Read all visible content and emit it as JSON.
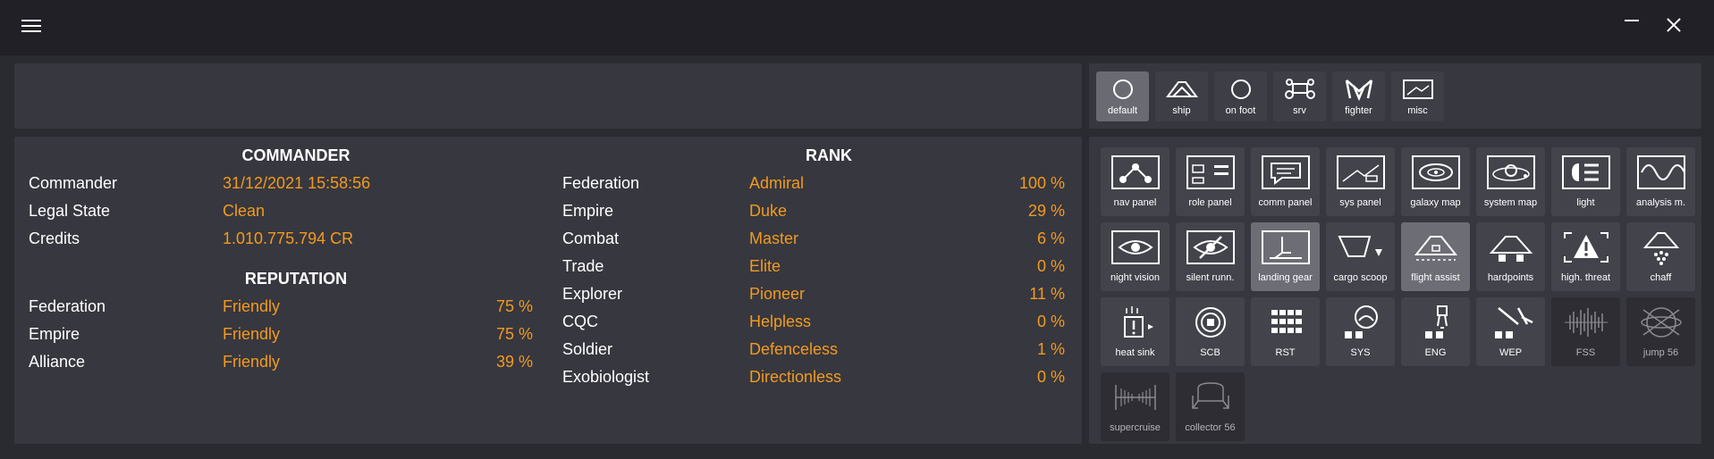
{
  "commander": {
    "title": "COMMANDER",
    "rows": [
      {
        "label": "Commander",
        "value": "31/12/2021 15:58:56"
      },
      {
        "label": "Legal State",
        "value": "Clean"
      },
      {
        "label": "Credits",
        "value": "1.010.775.794 CR"
      }
    ]
  },
  "reputation": {
    "title": "REPUTATION",
    "rows": [
      {
        "label": "Federation",
        "value": "Friendly",
        "percent": "75 %"
      },
      {
        "label": "Empire",
        "value": "Friendly",
        "percent": "75 %"
      },
      {
        "label": "Alliance",
        "value": "Friendly",
        "percent": "39 %"
      }
    ]
  },
  "rank": {
    "title": "RANK",
    "rows": [
      {
        "label": "Federation",
        "value": "Admiral",
        "percent": "100 %"
      },
      {
        "label": "Empire",
        "value": "Duke",
        "percent": "29 %"
      },
      {
        "label": "Combat",
        "value": "Master",
        "percent": "6 %"
      },
      {
        "label": "Trade",
        "value": "Elite",
        "percent": "0 %"
      },
      {
        "label": "Explorer",
        "value": "Pioneer",
        "percent": "11 %"
      },
      {
        "label": "CQC",
        "value": "Helpless",
        "percent": "0 %"
      },
      {
        "label": "Soldier",
        "value": "Defenceless",
        "percent": "1 %"
      },
      {
        "label": "Exobiologist",
        "value": "Directionless",
        "percent": "0 %"
      }
    ]
  },
  "modes": [
    {
      "label": "default",
      "icon": "circle-icon",
      "active": true
    },
    {
      "label": "ship",
      "icon": "ship-icon",
      "active": false
    },
    {
      "label": "on foot",
      "icon": "circle-icon",
      "active": false
    },
    {
      "label": "srv",
      "icon": "srv-icon",
      "active": false
    },
    {
      "label": "fighter",
      "icon": "fighter-icon",
      "active": false
    },
    {
      "label": "misc",
      "icon": "misc-icon",
      "active": false
    }
  ],
  "buttons": [
    {
      "label": "nav panel",
      "icon": "nav-panel-icon",
      "state": "normal"
    },
    {
      "label": "role panel",
      "icon": "role-panel-icon",
      "state": "normal"
    },
    {
      "label": "comm panel",
      "icon": "comm-panel-icon",
      "state": "normal"
    },
    {
      "label": "sys panel",
      "icon": "sys-panel-icon",
      "state": "normal"
    },
    {
      "label": "galaxy map",
      "icon": "galaxy-map-icon",
      "state": "normal"
    },
    {
      "label": "system map",
      "icon": "system-map-icon",
      "state": "normal"
    },
    {
      "label": "light",
      "icon": "light-icon",
      "state": "normal"
    },
    {
      "label": "analysis m.",
      "icon": "analysis-mode-icon",
      "state": "normal"
    },
    {
      "label": "night vision",
      "icon": "night-vision-icon",
      "state": "normal"
    },
    {
      "label": "silent runn.",
      "icon": "silent-running-icon",
      "state": "normal"
    },
    {
      "label": "landing gear",
      "icon": "landing-gear-icon",
      "state": "active"
    },
    {
      "label": "cargo scoop",
      "icon": "cargo-scoop-icon",
      "state": "normal"
    },
    {
      "label": "flight assist",
      "icon": "flight-assist-icon",
      "state": "active"
    },
    {
      "label": "hardpoints",
      "icon": "hardpoints-icon",
      "state": "normal"
    },
    {
      "label": "high. threat",
      "icon": "high-threat-icon",
      "state": "normal"
    },
    {
      "label": "chaff",
      "icon": "chaff-icon",
      "state": "normal"
    },
    {
      "label": "heat sink",
      "icon": "heat-sink-icon",
      "state": "normal"
    },
    {
      "label": "SCB",
      "icon": "scb-icon",
      "state": "normal"
    },
    {
      "label": "RST",
      "icon": "rst-icon",
      "state": "normal"
    },
    {
      "label": "SYS",
      "icon": "sys-icon",
      "state": "normal"
    },
    {
      "label": "ENG",
      "icon": "eng-icon",
      "state": "normal"
    },
    {
      "label": "WEP",
      "icon": "wep-icon",
      "state": "normal"
    },
    {
      "label": "FSS",
      "icon": "fss-icon",
      "state": "dim"
    },
    {
      "label": "jump 56",
      "icon": "jump-icon",
      "state": "dim"
    },
    {
      "label": "supercruise",
      "icon": "supercruise-icon",
      "state": "dim"
    },
    {
      "label": "collector 56",
      "icon": "collector-icon",
      "state": "dim"
    }
  ],
  "colors": {
    "accent": "#f29b1e",
    "panel": "#37373f",
    "background": "#2a2a31",
    "titlebar": "#202026"
  }
}
